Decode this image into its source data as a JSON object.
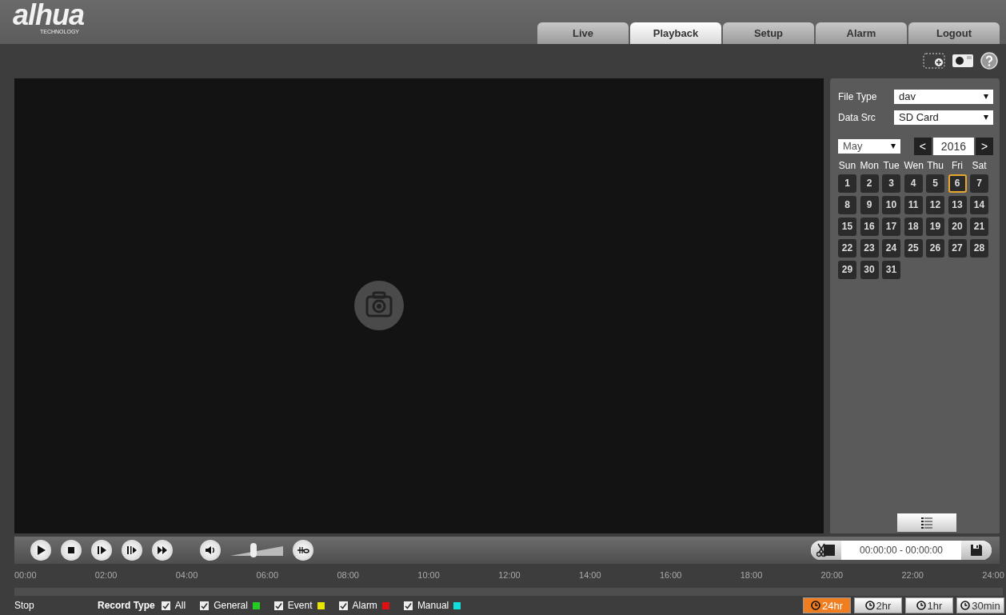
{
  "logo": {
    "name": "alhua",
    "tagline": "TECHNOLOGY"
  },
  "tabs": [
    {
      "label": "Live",
      "selected": false
    },
    {
      "label": "Playback",
      "selected": true
    },
    {
      "label": "Setup",
      "selected": false
    },
    {
      "label": "Alarm",
      "selected": false
    },
    {
      "label": "Logout",
      "selected": false
    }
  ],
  "sidebar": {
    "file_type": {
      "label": "File Type",
      "value": "dav"
    },
    "data_src": {
      "label": "Data Src",
      "value": "SD Card"
    },
    "month": "May",
    "prev": "<",
    "year": "2016",
    "next": ">",
    "weekdays": [
      "Sun",
      "Mon",
      "Tue",
      "Wen",
      "Thu",
      "Fri",
      "Sat"
    ],
    "days": [
      {
        "label": "1",
        "selected": false
      },
      {
        "label": "2",
        "selected": false
      },
      {
        "label": "3",
        "selected": false
      },
      {
        "label": "4",
        "selected": false
      },
      {
        "label": "5",
        "selected": false
      },
      {
        "label": "6",
        "selected": true
      },
      {
        "label": "7",
        "selected": false
      },
      {
        "label": "8",
        "selected": false
      },
      {
        "label": "9",
        "selected": false
      },
      {
        "label": "10",
        "selected": false
      },
      {
        "label": "11",
        "selected": false
      },
      {
        "label": "12",
        "selected": false
      },
      {
        "label": "13",
        "selected": false
      },
      {
        "label": "14",
        "selected": false
      },
      {
        "label": "15",
        "selected": false
      },
      {
        "label": "16",
        "selected": false
      },
      {
        "label": "17",
        "selected": false
      },
      {
        "label": "18",
        "selected": false
      },
      {
        "label": "19",
        "selected": false
      },
      {
        "label": "20",
        "selected": false
      },
      {
        "label": "21",
        "selected": false
      },
      {
        "label": "22",
        "selected": false
      },
      {
        "label": "23",
        "selected": false
      },
      {
        "label": "24",
        "selected": false
      },
      {
        "label": "25",
        "selected": false
      },
      {
        "label": "26",
        "selected": false
      },
      {
        "label": "27",
        "selected": false
      },
      {
        "label": "28",
        "selected": false
      },
      {
        "label": "29",
        "selected": false
      },
      {
        "label": "30",
        "selected": false
      },
      {
        "label": "31",
        "selected": false
      }
    ]
  },
  "volume": {
    "level": 0.43
  },
  "clip": {
    "range": "00:00:00 - 00:00:00"
  },
  "timeline": {
    "labels": [
      "00:00",
      "02:00",
      "04:00",
      "06:00",
      "08:00",
      "10:00",
      "12:00",
      "14:00",
      "16:00",
      "18:00",
      "20:00",
      "22:00",
      "24:00"
    ]
  },
  "status": "Stop",
  "record_type": {
    "label": "Record Type",
    "types": [
      {
        "label": "All",
        "checked": true
      },
      {
        "label": "General",
        "checked": true,
        "color": "#22cc22"
      },
      {
        "label": "Event",
        "checked": true,
        "color": "#e6e600"
      },
      {
        "label": "Alarm",
        "checked": true,
        "color": "#dd1111"
      },
      {
        "label": "Manual",
        "checked": true,
        "color": "#11dddd"
      }
    ]
  },
  "zoom": [
    {
      "label": "24hr",
      "selected": true
    },
    {
      "label": "2hr",
      "selected": false
    },
    {
      "label": "1hr",
      "selected": false
    },
    {
      "label": "30min",
      "selected": false
    }
  ]
}
